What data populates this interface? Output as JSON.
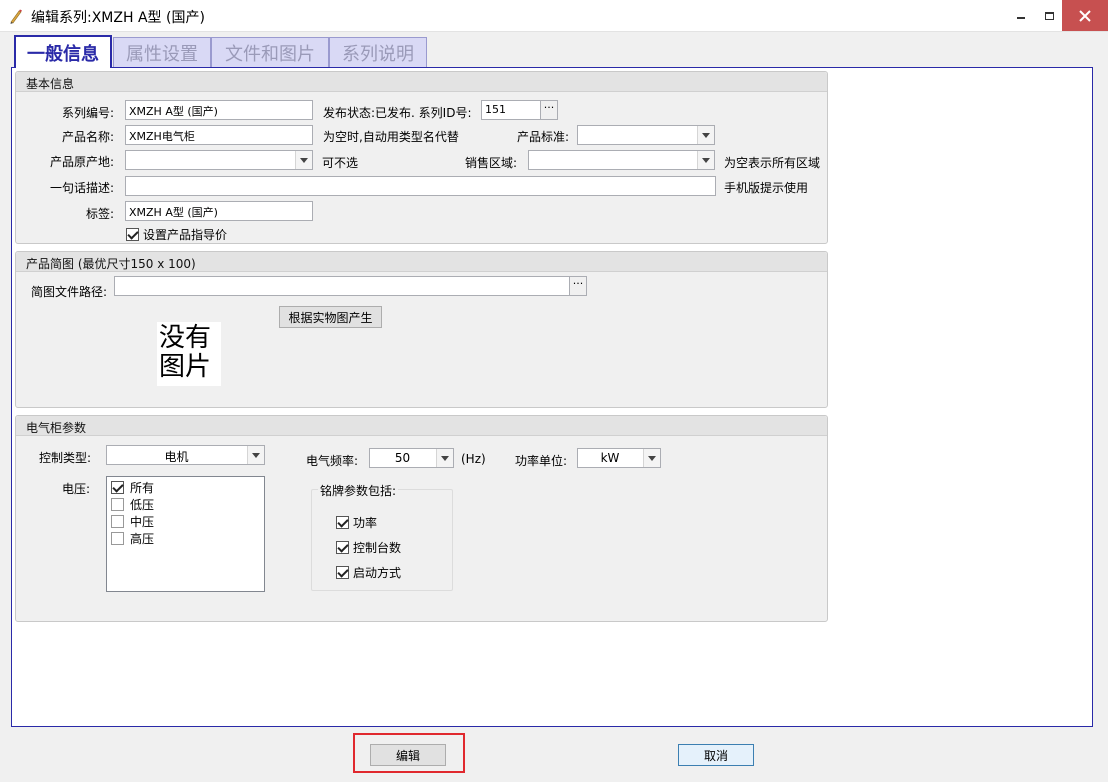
{
  "window": {
    "title": "编辑系列:XMZH A型 (国产)",
    "close_color": "#c75050"
  },
  "tabs": [
    {
      "label": "一般信息",
      "active": true
    },
    {
      "label": "属性设置",
      "active": false
    },
    {
      "label": "文件和图片",
      "active": false
    },
    {
      "label": "系列说明",
      "active": false
    }
  ],
  "basic": {
    "header": "基本信息",
    "series_no_label": "系列编号:",
    "series_no_value": "XMZH A型 (国产)",
    "publish_status": "发布状态:已发布. 系列ID号:",
    "series_id": "151",
    "product_name_label": "产品名称:",
    "product_name_value": "XMZH电气柜",
    "product_name_hint": "为空时,自动用类型名代替",
    "standard_label": "产品标准:",
    "standard_value": "",
    "origin_label": "产品原产地:",
    "origin_value": "",
    "origin_hint": "可不选",
    "sales_region_label": "销售区域:",
    "sales_region_value": "",
    "sales_region_hint": "为空表示所有区域",
    "one_line_label": "一句话描述:",
    "one_line_value": "",
    "one_line_hint": "手机版提示使用",
    "tags_label": "标签:",
    "tags_value": "XMZH A型 (国产)",
    "guide_price_label": "设置产品指导价",
    "guide_price_checked": true
  },
  "thumbnail": {
    "header": "产品简图 (最优尺寸150 x 100)",
    "path_label": "简图文件路径:",
    "path_value": "",
    "generate_button": "根据实物图产生",
    "no_image_line1": "没有",
    "no_image_line2": "图片"
  },
  "params": {
    "header": "电气柜参数",
    "control_type_label": "控制类型:",
    "control_type_value": "电机",
    "frequency_label": "电气频率:",
    "frequency_value": "50",
    "frequency_unit": "(Hz)",
    "power_unit_label": "功率单位:",
    "power_unit_value": "kW",
    "voltage_label": "电压:",
    "voltage_items": [
      {
        "label": "所有",
        "checked": true
      },
      {
        "label": "低压",
        "checked": false
      },
      {
        "label": "中压",
        "checked": false
      },
      {
        "label": "高压",
        "checked": false
      }
    ],
    "nameplate_legend": "铭牌参数包括:",
    "nameplate_items": [
      {
        "label": "功率",
        "checked": true
      },
      {
        "label": "控制台数",
        "checked": true
      },
      {
        "label": "启动方式",
        "checked": true
      }
    ]
  },
  "footer": {
    "edit_button": "编辑",
    "cancel_button": "取消",
    "highlight_color": "#e0282e"
  },
  "accent_color": "#2a2aa8"
}
